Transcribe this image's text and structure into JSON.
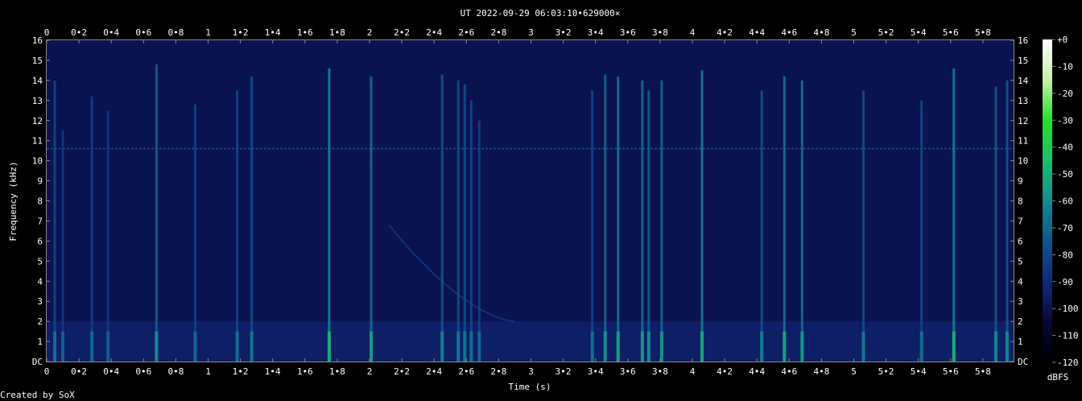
{
  "chart_data": {
    "type": "heatmap",
    "title": "UT 2022-09-29 06:03:10•629000×",
    "xlabel": "Time (s)",
    "ylabel": "Frequency (kHz)",
    "xlim": [
      0,
      5.99
    ],
    "ylim": [
      0,
      16
    ],
    "x_ticks": [
      "0",
      "0•2",
      "0•4",
      "0•6",
      "0•8",
      "1",
      "1•2",
      "1•4",
      "1•6",
      "1•8",
      "2",
      "2•2",
      "2•4",
      "2•6",
      "2•8",
      "3",
      "3•2",
      "3•4",
      "3•6",
      "3•8",
      "4",
      "4•2",
      "4•4",
      "4•6",
      "4•8",
      "5",
      "5•2",
      "5•4",
      "5•6",
      "5•8"
    ],
    "x_tick_values": [
      0,
      0.2,
      0.4,
      0.6,
      0.8,
      1,
      1.2,
      1.4,
      1.6,
      1.8,
      2,
      2.2,
      2.4,
      2.6,
      2.8,
      3,
      3.2,
      3.4,
      3.6,
      3.8,
      4,
      4.2,
      4.4,
      4.6,
      4.8,
      5,
      5.2,
      5.4,
      5.6,
      5.8
    ],
    "y_ticks": [
      "DC",
      "1",
      "2",
      "3",
      "4",
      "5",
      "6",
      "7",
      "8",
      "9",
      "10",
      "11",
      "12",
      "13",
      "14",
      "15",
      "16"
    ],
    "y_tick_values": [
      0,
      1,
      2,
      3,
      4,
      5,
      6,
      7,
      8,
      9,
      10,
      11,
      12,
      13,
      14,
      15,
      16
    ],
    "colorbar": {
      "label": "dBFS",
      "ticks": [
        "+0",
        "-10",
        "-20",
        "-30",
        "-40",
        "-50",
        "-60",
        "-70",
        "-80",
        "-90",
        "-100",
        "-110",
        "-120"
      ],
      "tick_values": [
        0,
        -10,
        -20,
        -30,
        -40,
        -50,
        -60,
        -70,
        -80,
        -90,
        -100,
        -110,
        -120
      ],
      "range": [
        -120,
        0
      ],
      "colors": [
        "#000000",
        "#07073a",
        "#102a7a",
        "#11548e",
        "#138a90",
        "#1bbf6c",
        "#22e025",
        "#c8f0a8",
        "#ffffff"
      ]
    },
    "noise_floor_dbfs": -100,
    "tone": {
      "frequency_khz": 10.6,
      "level_dbfs": -80
    },
    "sweep": {
      "start_time_s": 2.12,
      "start_freq_khz": 6.8,
      "end_time_s": 2.9,
      "end_freq_khz": 2.0,
      "level_dbfs": -85
    },
    "impulses": [
      {
        "time_s": 0.05,
        "top_khz": 14.0,
        "level_dbfs": -80
      },
      {
        "time_s": 0.1,
        "top_khz": 11.5,
        "level_dbfs": -84
      },
      {
        "time_s": 0.28,
        "top_khz": 13.2,
        "level_dbfs": -82
      },
      {
        "time_s": 0.38,
        "top_khz": 12.5,
        "level_dbfs": -85
      },
      {
        "time_s": 0.68,
        "top_khz": 14.8,
        "level_dbfs": -72
      },
      {
        "time_s": 0.92,
        "top_khz": 12.8,
        "level_dbfs": -82
      },
      {
        "time_s": 1.18,
        "top_khz": 13.5,
        "level_dbfs": -80
      },
      {
        "time_s": 1.27,
        "top_khz": 14.2,
        "level_dbfs": -78
      },
      {
        "time_s": 1.75,
        "top_khz": 14.6,
        "level_dbfs": -62
      },
      {
        "time_s": 2.01,
        "top_khz": 14.2,
        "level_dbfs": -68
      },
      {
        "time_s": 2.45,
        "top_khz": 14.3,
        "level_dbfs": -76
      },
      {
        "time_s": 2.55,
        "top_khz": 14.0,
        "level_dbfs": -78
      },
      {
        "time_s": 2.59,
        "top_khz": 13.8,
        "level_dbfs": -78
      },
      {
        "time_s": 2.63,
        "top_khz": 13.0,
        "level_dbfs": -80
      },
      {
        "time_s": 2.68,
        "top_khz": 12.0,
        "level_dbfs": -82
      },
      {
        "time_s": 3.38,
        "top_khz": 13.5,
        "level_dbfs": -80
      },
      {
        "time_s": 3.46,
        "top_khz": 14.3,
        "level_dbfs": -70
      },
      {
        "time_s": 3.54,
        "top_khz": 14.2,
        "level_dbfs": -66
      },
      {
        "time_s": 3.69,
        "top_khz": 14.0,
        "level_dbfs": -68
      },
      {
        "time_s": 3.73,
        "top_khz": 13.5,
        "level_dbfs": -72
      },
      {
        "time_s": 3.81,
        "top_khz": 14.0,
        "level_dbfs": -70
      },
      {
        "time_s": 4.06,
        "top_khz": 14.5,
        "level_dbfs": -64
      },
      {
        "time_s": 4.43,
        "top_khz": 13.5,
        "level_dbfs": -76
      },
      {
        "time_s": 4.57,
        "top_khz": 14.2,
        "level_dbfs": -66
      },
      {
        "time_s": 4.68,
        "top_khz": 14.0,
        "level_dbfs": -68
      },
      {
        "time_s": 5.06,
        "top_khz": 13.5,
        "level_dbfs": -78
      },
      {
        "time_s": 5.42,
        "top_khz": 13.0,
        "level_dbfs": -80
      },
      {
        "time_s": 5.62,
        "top_khz": 14.6,
        "level_dbfs": -62
      },
      {
        "time_s": 5.88,
        "top_khz": 13.7,
        "level_dbfs": -74
      },
      {
        "time_s": 5.95,
        "top_khz": 14.0,
        "level_dbfs": -74
      }
    ],
    "grid": false
  },
  "footer": {
    "credit": "Created by SoX"
  }
}
